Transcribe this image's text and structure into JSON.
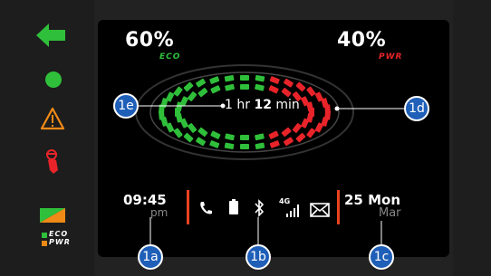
{
  "gauge": {
    "eco_percent": "60%",
    "eco_label": "ECO",
    "pwr_percent": "40%",
    "pwr_label": "PWR",
    "time_hr": "1",
    "time_hr_unit": "hr",
    "time_min": "12",
    "time_min_unit": "min"
  },
  "clock": {
    "time": "09:45",
    "ampm": "pm"
  },
  "date": {
    "day": "25",
    "weekday": "Mon",
    "month": "Mar"
  },
  "status_icons": {
    "network": "4G",
    "icons": [
      "phone-icon",
      "battery-icon",
      "bluetooth-icon",
      "signal-icon",
      "mail-icon"
    ]
  },
  "indicators": [
    "turn-left-arrow-icon",
    "green-dot-icon",
    "warning-triangle-icon",
    "kickstand-icon",
    "mode-flag-icon"
  ],
  "legend": {
    "eco": "ECO",
    "pwr": "PWR"
  },
  "callouts": {
    "a": "1a",
    "b": "1b",
    "c": "1c",
    "d": "1d",
    "e": "1e"
  },
  "colors": {
    "eco": "#2fbf3a",
    "pwr": "#e8242a",
    "accent": "#e8421f",
    "callout": "#1f5fb8"
  }
}
